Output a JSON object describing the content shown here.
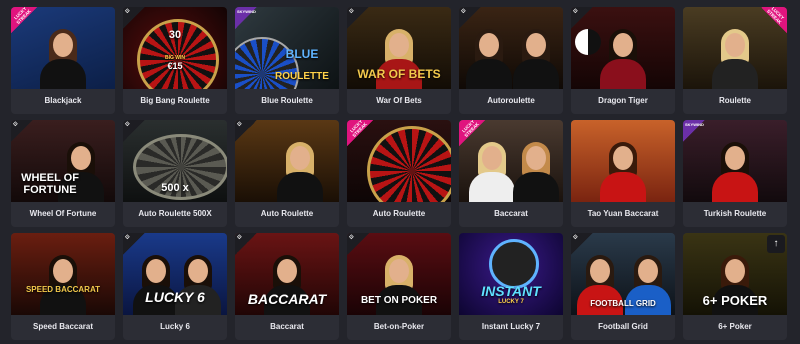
{
  "games": [
    {
      "title": "Blackjack",
      "ribbon": "LUCKY STREAK"
    },
    {
      "title": "Big Bang Roulette",
      "art_number": "30",
      "art_caption": "BIG WIN",
      "art_amount": "€15"
    },
    {
      "title": "Blue Roulette",
      "provider": "SKYWIND",
      "art_title": "BLUE",
      "art_sub": "ROULETTE"
    },
    {
      "title": "War Of Bets",
      "art_title": "WAR OF BETS"
    },
    {
      "title": "Autoroulette"
    },
    {
      "title": "Dragon Tiger"
    },
    {
      "title": "Roulette",
      "ribbon": "LUCKY STREAK"
    },
    {
      "title": "Wheel Of Fortune",
      "art_title": "WHEEL OF FORTUNE"
    },
    {
      "title": "Auto Roulette 500X",
      "art_title": "500 x"
    },
    {
      "title": "Auto Roulette"
    },
    {
      "title": "Auto Roulette",
      "ribbon": "LUCKY STREAK"
    },
    {
      "title": "Baccarat",
      "ribbon": "LUCKY STREAK"
    },
    {
      "title": "Tao Yuan Baccarat"
    },
    {
      "title": "Turkish Roulette",
      "ribbon": "SKYWIND"
    },
    {
      "title": "Speed Baccarat",
      "art_title": "SPEED BACCARAT"
    },
    {
      "title": "Lucky 6",
      "art_title": "LUCKY 6"
    },
    {
      "title": "Baccarat",
      "art_title": "BACCARAT"
    },
    {
      "title": "Bet-on-Poker",
      "art_title": "BET ON POKER"
    },
    {
      "title": "Instant Lucky 7",
      "art_title": "INSTANT",
      "art_sub": "LUCKY 7"
    },
    {
      "title": "Football Grid",
      "art_title": "FOOTBALL GRID"
    },
    {
      "title": "6+ Poker",
      "art_title": "6+ POKER"
    }
  ],
  "scroll_top_icon": "↑"
}
